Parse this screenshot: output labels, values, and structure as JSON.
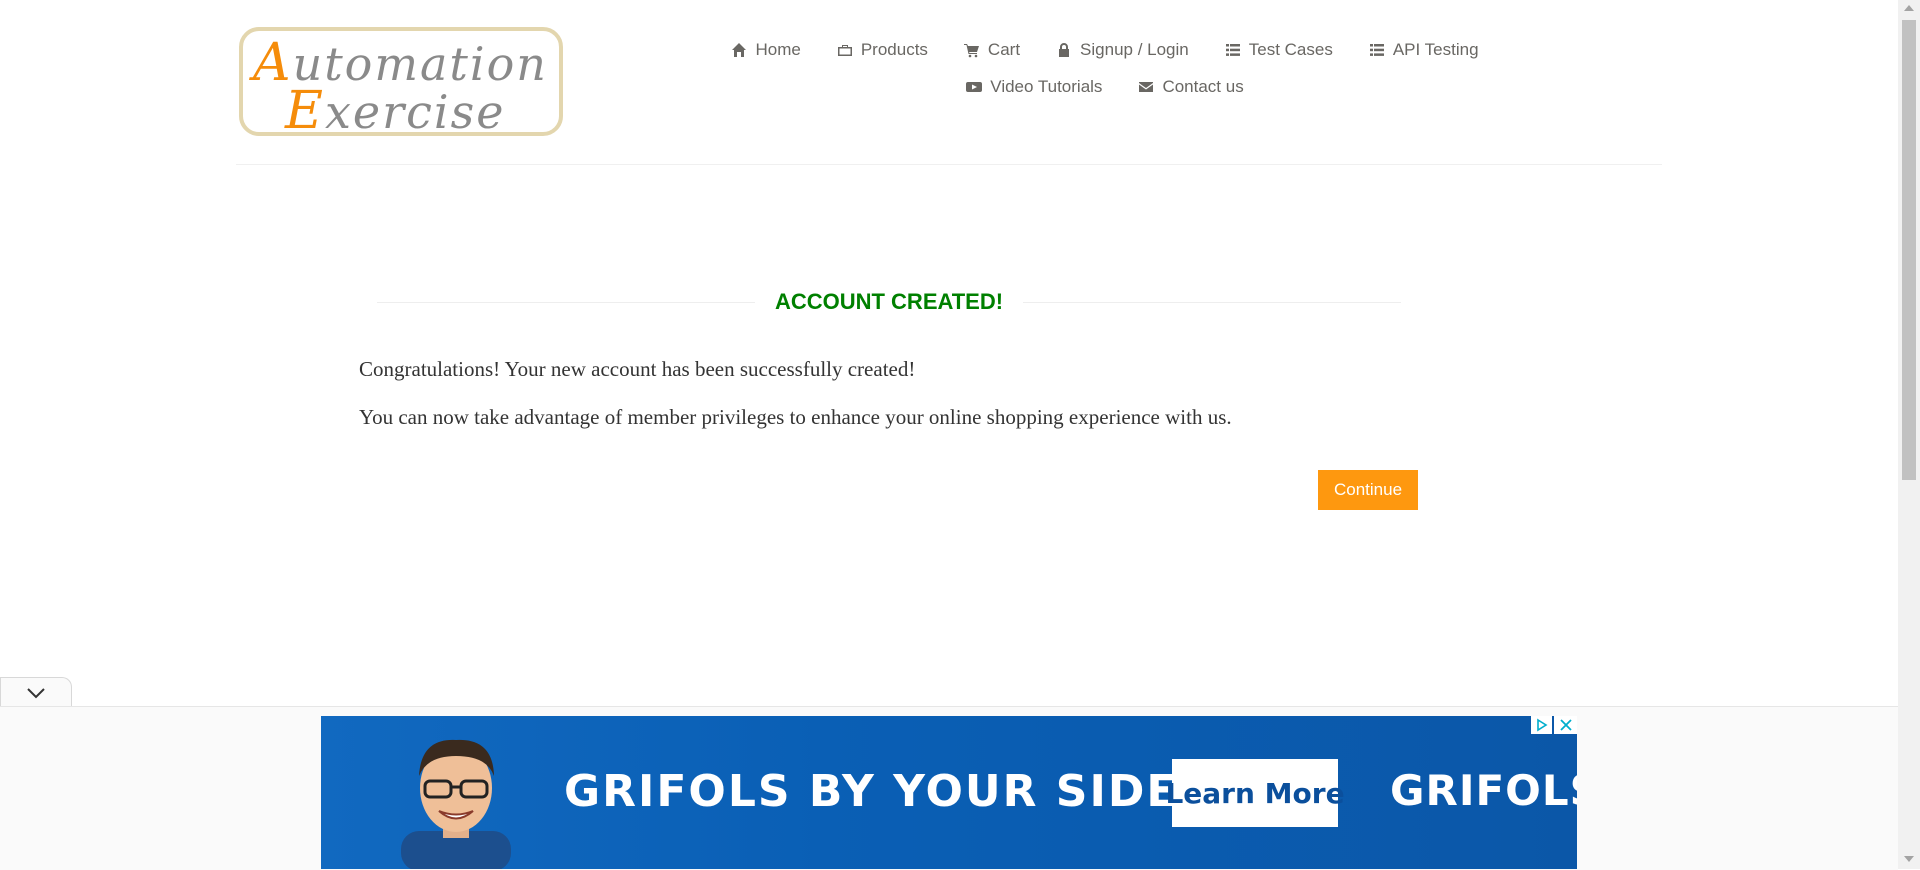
{
  "logo": {
    "line1_cap": "A",
    "line1_rest": "utomation",
    "line2_cap": "E",
    "line2_rest": "xercise"
  },
  "nav": {
    "row1": [
      {
        "label": "Home",
        "icon": "home-icon"
      },
      {
        "label": "Products",
        "icon": "briefcase-icon"
      },
      {
        "label": "Cart",
        "icon": "cart-icon"
      },
      {
        "label": "Signup / Login",
        "icon": "lock-icon"
      },
      {
        "label": "Test Cases",
        "icon": "list-icon"
      },
      {
        "label": "API Testing",
        "icon": "list-icon"
      }
    ],
    "row2": [
      {
        "label": "Video Tutorials",
        "icon": "youtube-icon"
      },
      {
        "label": "Contact us",
        "icon": "envelope-icon"
      }
    ]
  },
  "main": {
    "title": "ACCOUNT CREATED!",
    "message1": "Congratulations! Your new account has been successfully created!",
    "message2": "You can now take advantage of member privileges to enhance your online shopping experience with us.",
    "continue_label": "Continue"
  },
  "ad": {
    "headline": "GRIFOLS BY YOUR SIDE",
    "cta": "Learn More",
    "brand": "GRIFOLS"
  },
  "colors": {
    "title_green": "#008000",
    "button_orange": "#fe980f",
    "nav_text": "#696763",
    "ad_blue": "#0b5cb0"
  }
}
